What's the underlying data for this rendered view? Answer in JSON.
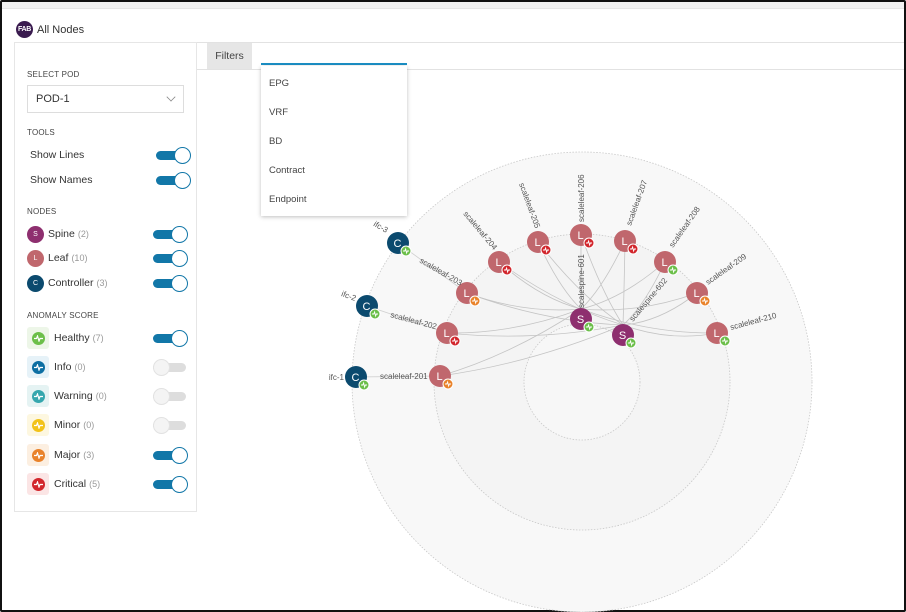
{
  "header": {
    "badge": "FAB",
    "title": "All Nodes"
  },
  "sidebar": {
    "select_pod_label": "SELECT POD",
    "pod_value": "POD-1",
    "tools_label": "TOOLS",
    "tools": [
      {
        "label": "Show Lines",
        "on": true
      },
      {
        "label": "Show Names",
        "on": true
      }
    ],
    "nodes_label": "NODES",
    "nodes": [
      {
        "letter": "S",
        "label": "Spine",
        "count": "(2)",
        "color": "#8e2f6f",
        "on": true
      },
      {
        "letter": "L",
        "label": "Leaf",
        "count": "(10)",
        "color": "#c0676d",
        "on": true
      },
      {
        "letter": "C",
        "label": "Controller",
        "count": "(3)",
        "color": "#0b4a6e",
        "on": true
      }
    ],
    "anomaly_label": "ANOMALY SCORE",
    "anomaly": [
      {
        "label": "Healthy",
        "count": "(7)",
        "color": "#6cbf4a",
        "bg": "#edf6e8",
        "on": true
      },
      {
        "label": "Info",
        "count": "(0)",
        "color": "#0d6fa3",
        "bg": "#e6f2f8",
        "on": false
      },
      {
        "label": "Warning",
        "count": "(0)",
        "color": "#35a7ae",
        "bg": "#e5f3f3",
        "on": false
      },
      {
        "label": "Minor",
        "count": "(0)",
        "color": "#f2c31a",
        "bg": "#fdf7e0",
        "on": false
      },
      {
        "label": "Major",
        "count": "(3)",
        "color": "#e9832b",
        "bg": "#fcefe1",
        "on": true
      },
      {
        "label": "Critical",
        "count": "(5)",
        "color": "#d2272d",
        "bg": "#fbe5e5",
        "on": true
      }
    ]
  },
  "filters": {
    "button_label": "Filters",
    "input_value": "",
    "options": [
      "EPG",
      "VRF",
      "BD",
      "Contract",
      "Endpoint"
    ]
  },
  "topology": {
    "controllers": [
      {
        "name": "ifc-3",
        "letter": "C",
        "status": "healthy"
      },
      {
        "name": "ifc-2",
        "letter": "C",
        "status": "healthy"
      },
      {
        "name": "ifc-1",
        "letter": "C",
        "status": "healthy"
      }
    ],
    "leaves": [
      {
        "name": "scaleleaf-201",
        "letter": "L",
        "status": "major"
      },
      {
        "name": "scaleleaf-202",
        "letter": "L",
        "status": "critical"
      },
      {
        "name": "scaleleaf-203",
        "letter": "L",
        "status": "major"
      },
      {
        "name": "scaleleaf-204",
        "letter": "L",
        "status": "critical"
      },
      {
        "name": "scaleleaf-205",
        "letter": "L",
        "status": "critical"
      },
      {
        "name": "scaleleaf-206",
        "letter": "L",
        "status": "critical"
      },
      {
        "name": "scaleleaf-207",
        "letter": "L",
        "status": "critical"
      },
      {
        "name": "scaleleaf-208",
        "letter": "L",
        "status": "healthy"
      },
      {
        "name": "scaleleaf-209",
        "letter": "L",
        "status": "major"
      },
      {
        "name": "scaleleaf-210",
        "letter": "L",
        "status": "healthy"
      }
    ],
    "spines": [
      {
        "name": "scalespine-601",
        "letter": "S",
        "status": "healthy"
      },
      {
        "name": "scalespine-602",
        "letter": "S",
        "status": "healthy"
      }
    ],
    "status_colors": {
      "healthy": "#6cbf4a",
      "major": "#e9832b",
      "critical": "#d2272d"
    },
    "type_colors": {
      "controller": "#0b4a6e",
      "leaf": "#c0676d",
      "spine": "#8e2f6f"
    }
  }
}
